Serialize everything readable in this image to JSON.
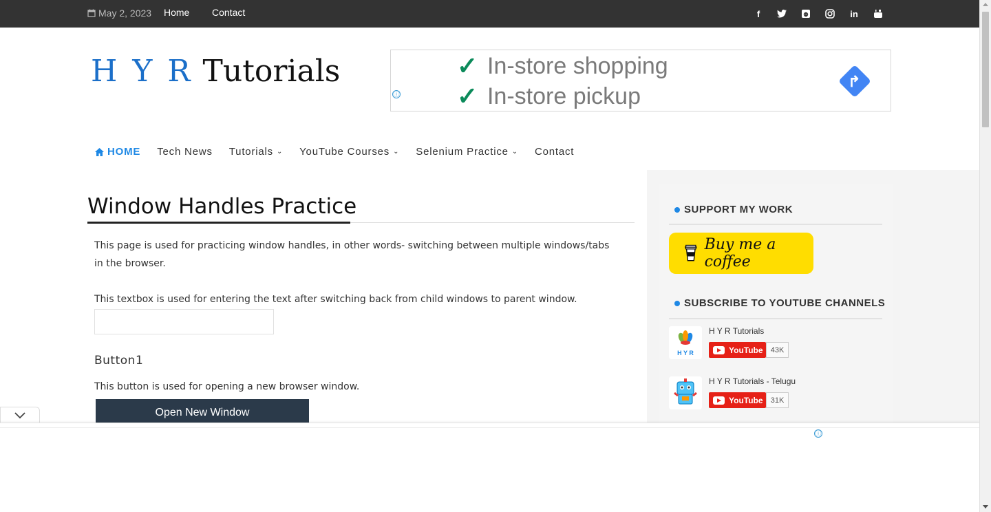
{
  "topbar": {
    "date": "May 2, 2023",
    "links": [
      "Home",
      "Contact"
    ],
    "social_icons": [
      "facebook-icon",
      "twitter-icon",
      "reddit-icon",
      "instagram-icon",
      "linkedin-icon",
      "youtube-icon"
    ]
  },
  "header": {
    "logo_prefix": "H Y R",
    "logo_suffix": "Tutorials",
    "ad": {
      "line1": "In-store shopping",
      "line2": "In-store pickup",
      "info_icon": "ⓘ"
    }
  },
  "nav": {
    "items": [
      {
        "label": "HOME",
        "icon": "home-icon",
        "active": true,
        "dropdown": false
      },
      {
        "label": "Tech News",
        "dropdown": false
      },
      {
        "label": "Tutorials",
        "dropdown": true
      },
      {
        "label": "YouTube Courses",
        "dropdown": true
      },
      {
        "label": "Selenium Practice",
        "dropdown": true
      },
      {
        "label": "Contact",
        "dropdown": false
      }
    ]
  },
  "main": {
    "title": "Window Handles Practice",
    "intro": "This page is used for practicing window handles, in other words- switching between multiple windows/tabs in the browser.",
    "textbox_label": "This textbox is used for entering the text after switching back from child windows to parent window.",
    "textbox_value": "",
    "section_heading": "Button1",
    "button1_desc": "This button is used for opening a new browser window.",
    "button1_label": "Open New Window"
  },
  "sidebar": {
    "support_title": "SUPPORT MY WORK",
    "coffee_label": "Buy me a coffee",
    "subscribe_title": "SUBSCRIBE TO YOUTUBE CHANNELS",
    "channels": [
      {
        "name": "H Y R Tutorials",
        "button": "YouTube",
        "count": "43K"
      },
      {
        "name": "H Y R Tutorials - Telugu",
        "button": "YouTube",
        "count": "31K"
      }
    ]
  },
  "colors": {
    "accent": "#1e88e5",
    "topbar_bg": "#333333",
    "button_bg": "#2b3a4a",
    "coffee_bg": "#ffdd00",
    "youtube_red": "#e62117"
  }
}
